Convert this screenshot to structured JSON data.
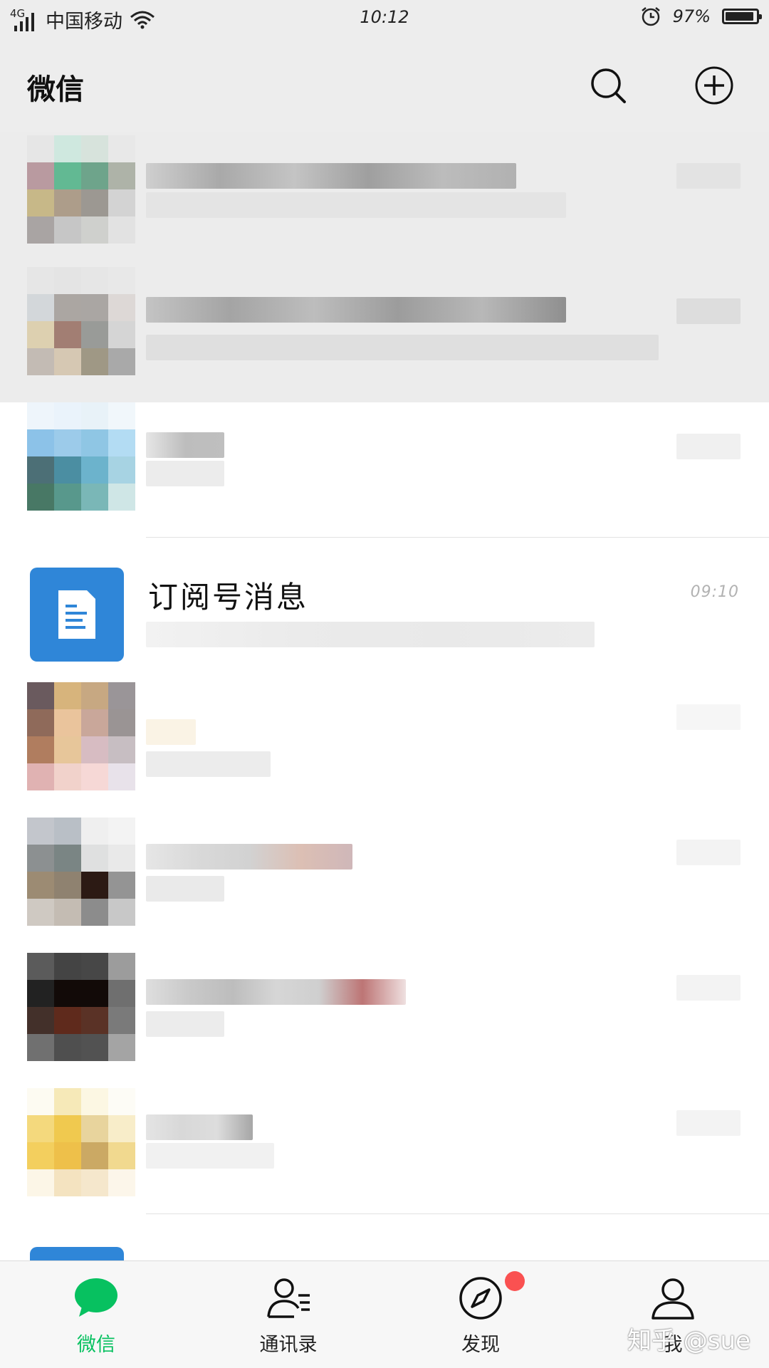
{
  "status_bar": {
    "network": "4G",
    "carrier": "中国移动",
    "time": "10:12",
    "battery": "97%"
  },
  "header": {
    "title": "微信",
    "search_icon": "search-icon",
    "add_icon": "plus-circle-icon"
  },
  "chats": [
    {
      "pinned": true,
      "name": "",
      "preview": "",
      "time": ""
    },
    {
      "pinned": true,
      "name": "",
      "preview": "",
      "time": ""
    },
    {
      "pinned": false,
      "name": "",
      "preview": "",
      "time": ""
    },
    {
      "pinned": false,
      "name": "订阅号消息",
      "preview": "",
      "time": "09:10",
      "icon": "document-icon"
    },
    {
      "pinned": false,
      "name": "",
      "preview": "",
      "time": ""
    },
    {
      "pinned": false,
      "name": "",
      "preview": "",
      "time": ""
    },
    {
      "pinned": false,
      "name": "",
      "preview": "",
      "time": ""
    },
    {
      "pinned": false,
      "name": "",
      "preview": "",
      "time": ""
    }
  ],
  "tabs": [
    {
      "label": "微信",
      "icon": "chat-bubble-icon",
      "active": true,
      "color": "#07c160"
    },
    {
      "label": "通讯录",
      "icon": "contacts-icon",
      "active": false
    },
    {
      "label": "发现",
      "icon": "compass-icon",
      "active": false,
      "badge": "red-dot"
    },
    {
      "label": "我",
      "icon": "person-icon",
      "active": false
    }
  ],
  "watermark": "知乎 @sue",
  "colors": {
    "accent": "#07c160",
    "header_bg": "#ededed",
    "subscription_blue": "#2f86d8",
    "badge_red": "#fa5151"
  }
}
